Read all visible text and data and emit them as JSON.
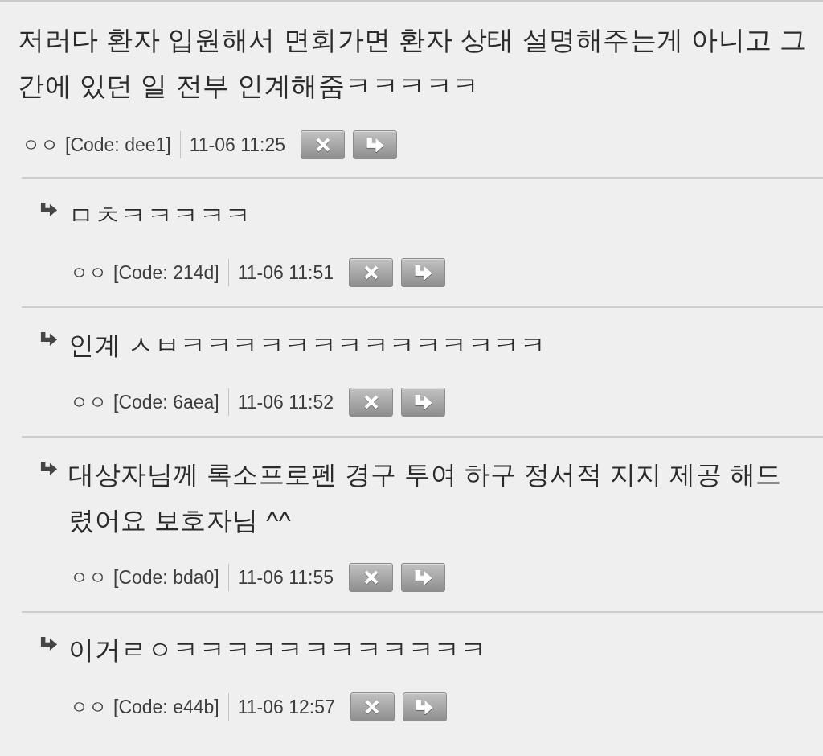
{
  "comment": {
    "text": "저러다 환자 입원해서 면회가면 환자 상태 설명해주는게 아니고 그간에 있던 일 전부 인계해줌ㅋㅋㅋㅋㅋ",
    "author": "ㅇㅇ",
    "code": "[Code: dee1]",
    "time": "11-06 11:25"
  },
  "replies": [
    {
      "text": "ㅁㅊㅋㅋㅋㅋㅋ",
      "author": "ㅇㅇ",
      "code": "[Code: 214d]",
      "time": "11-06 11:51"
    },
    {
      "text": "인계 ㅅㅂㅋㅋㅋㅋㅋㅋㅋㅋㅋㅋㅋㅋㅋㅋ",
      "author": "ㅇㅇ",
      "code": "[Code: 6aea]",
      "time": "11-06 11:52"
    },
    {
      "text": "대상자님께 록소프로펜 경구 투여 하구 정서적 지지 제공 해드렸어요 보호자님 ^^",
      "author": "ㅇㅇ",
      "code": "[Code: bda0]",
      "time": "11-06 11:55"
    },
    {
      "text": "이거ㄹㅇㅋㅋㅋㅋㅋㅋㅋㅋㅋㅋㅋㅋ",
      "author": "ㅇㅇ",
      "code": "[Code: e44b]",
      "time": "11-06 12:57"
    }
  ]
}
